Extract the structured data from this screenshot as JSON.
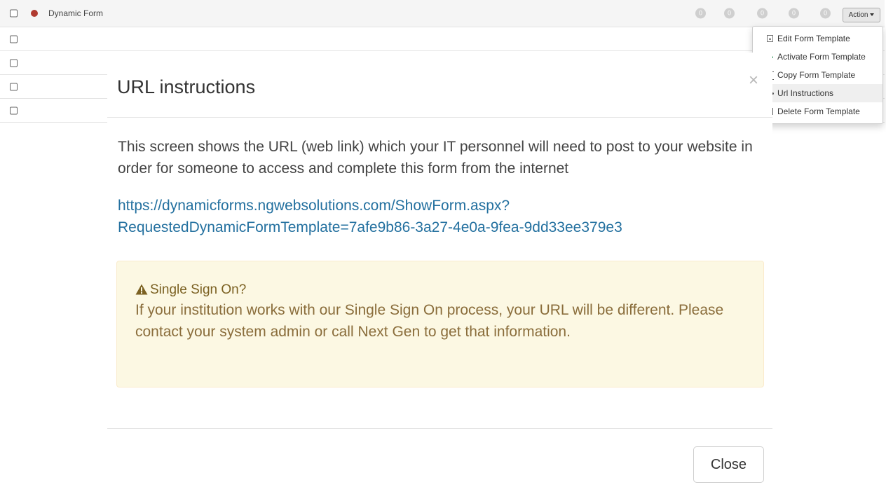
{
  "table": {
    "first_row": {
      "name": "Dynamic Form",
      "badges": [
        "0",
        "0",
        "0",
        "0",
        "0"
      ],
      "action_label": "Action"
    }
  },
  "dropdown": {
    "items": [
      {
        "label": "Edit Form Template",
        "icon": "document-icon"
      },
      {
        "label": "Activate Form Template",
        "icon": "activate-icon"
      },
      {
        "label": "Copy Form Template",
        "icon": "copy-icon"
      },
      {
        "label": "Url Instructions",
        "icon": "link-icon"
      },
      {
        "label": "Delete Form Template",
        "icon": "trash-icon"
      }
    ]
  },
  "modal": {
    "title": "URL instructions",
    "close_glyph": "×",
    "body": "This screen shows the URL (web link) which your IT personnel will need to post to your website in order for someone to access and complete this form from the internet",
    "url_line1": "https://dynamicforms.ngwebsolutions.com/ShowForm.aspx?",
    "url_line2": "RequestedDynamicFormTemplate=7afe9b86-3a27-4e0a-9fea-9dd33ee379e3",
    "alert": {
      "heading": "Single Sign On?",
      "text": "If your institution works with our Single Sign On process, your URL will be different. Please contact your system admin or call Next Gen to get that information."
    },
    "close_label": "Close"
  },
  "colors": {
    "status_dot": "#b03a30",
    "link": "#23709f",
    "alert_bg": "#fcf8e3",
    "alert_text": "#8a6d3b"
  }
}
